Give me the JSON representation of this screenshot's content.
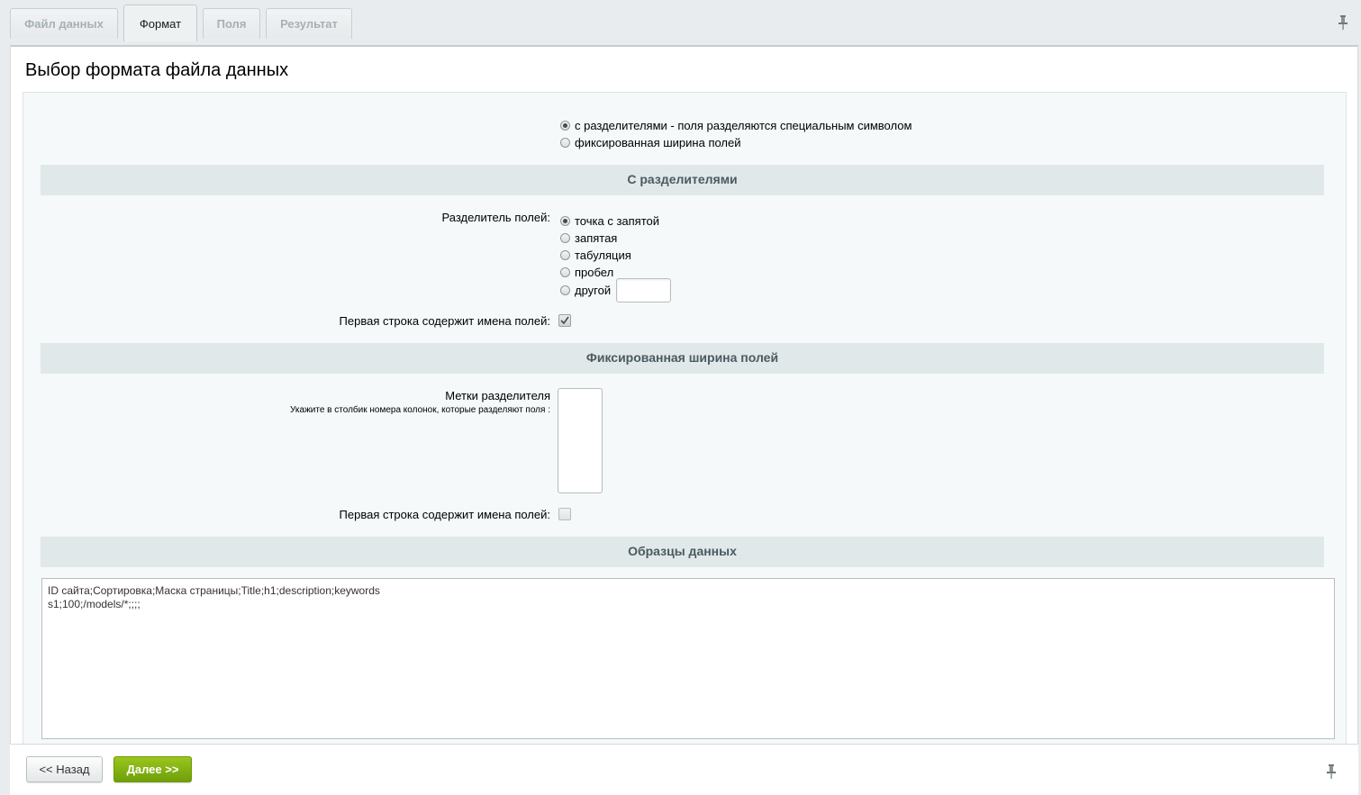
{
  "tabs": [
    {
      "label": "Файл данных",
      "active": false
    },
    {
      "label": "Формат",
      "active": true
    },
    {
      "label": "Поля",
      "active": false
    },
    {
      "label": "Результат",
      "active": false
    }
  ],
  "page": {
    "title": "Выбор формата файла данных"
  },
  "format": {
    "options": [
      {
        "label": "с разделителями - поля разделяются специальным символом",
        "selected": true
      },
      {
        "label": "фиксированная ширина полей",
        "selected": false
      }
    ]
  },
  "delimited": {
    "title": "С разделителями",
    "separator_label": "Разделитель полей:",
    "separators": [
      {
        "label": "точка с запятой",
        "selected": true
      },
      {
        "label": "запятая",
        "selected": false
      },
      {
        "label": "табуляция",
        "selected": false
      },
      {
        "label": "пробел",
        "selected": false
      },
      {
        "label": "другой",
        "selected": false
      }
    ],
    "other_value": "",
    "first_row_label": "Первая строка содержит имена полей:",
    "first_row_checked": true
  },
  "fixed": {
    "title": "Фиксированная ширина полей",
    "marks_label": "Метки разделителя",
    "marks_hint": "Укажите в столбик номера колонок, которые разделяют поля :",
    "marks_value": "",
    "first_row_label": "Первая строка содержит имена полей:",
    "first_row_checked": false
  },
  "samples": {
    "title": "Образцы данных",
    "text": "ID сайта;Сортировка;Маска страницы;Title;h1;description;keywords\ns1;100;/models/*;;;;"
  },
  "buttons": {
    "back": "<< Назад",
    "next": "Далее >>"
  },
  "icons": {
    "pin": "pin-icon"
  },
  "colors": {
    "accent": "#7aa80f",
    "section": "#e0e8e9",
    "background": "#e8ecee"
  }
}
